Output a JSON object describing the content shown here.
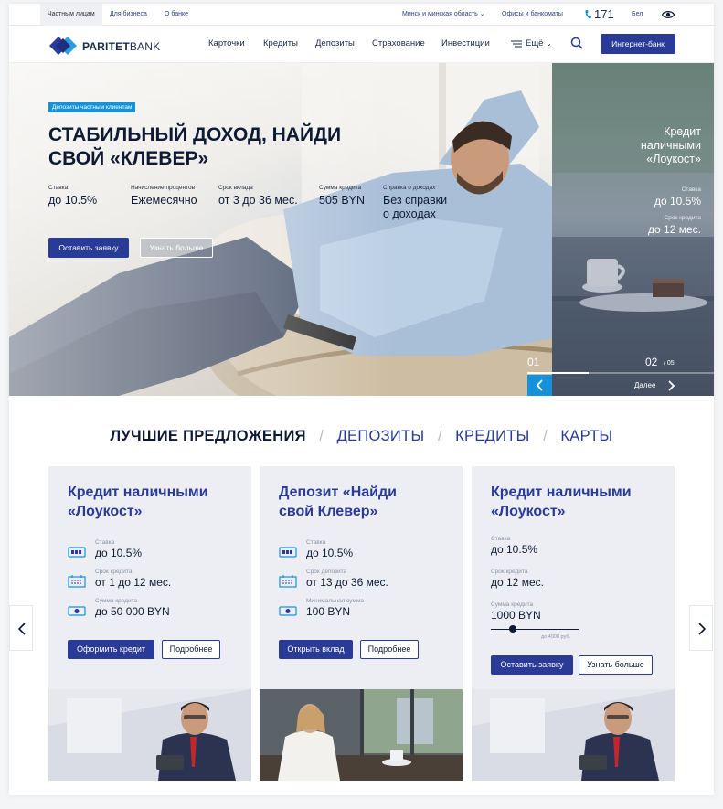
{
  "topbar": {
    "segments": [
      "Частным лицам",
      "Для бизнеса",
      "О банке"
    ],
    "region": "Минск и минская область",
    "offices": "Офисы и банкоматы",
    "phone": "171",
    "language": "Бел"
  },
  "header": {
    "brand_bold": "PARITET",
    "brand_rest": "BANK",
    "nav": [
      "Карточки",
      "Кредиты",
      "Депозиты",
      "Страхование",
      "Инвестиции",
      "Ещё"
    ],
    "internet_bank": "Интернет-банк"
  },
  "hero": {
    "tag": "Депозиты частным клиентам",
    "title_line1": "СТАБИЛЬНЫЙ ДОХОД, НАЙДИ",
    "title_line2": "СВОЙ «КЛЕВЕР»",
    "stats": [
      {
        "label": "Ставка",
        "value": "до 10.5%"
      },
      {
        "label": "Начисление процентов",
        "value": "Ежемесячно"
      },
      {
        "label": "Срок вклада",
        "value": "от 3 до 36 мес."
      },
      {
        "label": "Сумма кредита",
        "value": "505 BYN"
      },
      {
        "label": "Справка о доходах",
        "value_line1": "Без справки",
        "value_line2": "о доходах"
      }
    ],
    "primary_button": "Оставить заявку",
    "secondary_button": "Узнать больше"
  },
  "side_slide": {
    "title_line1": "Кредит",
    "title_line2": "наличными",
    "title_line3": "«Лоукост»",
    "rate_label": "Ставка",
    "rate_value": "до 10.5%",
    "term_label": "Срок кредита",
    "term_value": "до 12 мес."
  },
  "pager": {
    "current": "01",
    "next_index": "02",
    "total": "/ 05",
    "progress": 0.33,
    "next_label": "Далее"
  },
  "offers": {
    "active_tab": "ЛУЧШИЕ ПРЕДЛОЖЕНИЯ",
    "tabs": [
      "ДЕПОЗИТЫ",
      "КРЕДИТЫ",
      "КАРТЫ"
    ],
    "separator": "/"
  },
  "cards": [
    {
      "title_line1": "Кредит наличными",
      "title_line2": "«Лоукост»",
      "rows": [
        {
          "label": "Ставка",
          "value": "до 10.5%"
        },
        {
          "label": "Срок кредита",
          "value": "от 1 до 12 мес."
        },
        {
          "label": "Сумма кредита",
          "value": "до 50 000 BYN"
        }
      ],
      "primary_button": "Оформить кредит",
      "secondary_button": "Подробнее"
    },
    {
      "title_line1": "Депозит «Найди",
      "title_line2": "свой Клевер»",
      "rows": [
        {
          "label": "Ставка",
          "value": "до 10.5%"
        },
        {
          "label": "Срок депозита",
          "value": "от 13 до 36 мес."
        },
        {
          "label": "Минимальная сумма",
          "value": "100 BYN"
        }
      ],
      "primary_button": "Открыть вклад",
      "secondary_button": "Подробнее"
    },
    {
      "title_line1": "Кредит наличными",
      "title_line2": "«Лоукост»",
      "rows": [
        {
          "label": "Ставка",
          "value": "до 10.5%"
        },
        {
          "label": "Срок кредита",
          "value": "до 12 мес."
        },
        {
          "label": "Сумма кредита",
          "value": "1000 BYN"
        }
      ],
      "slider_position": 0.25,
      "slider_max_label": "до 4000 руб.",
      "primary_button": "Оставить заявку",
      "secondary_button": "Узнать больше"
    }
  ],
  "colors": {
    "brand_navy": "#2a3a97",
    "accent_blue": "#1592d9",
    "text_dark": "#0e1a33",
    "card_bg": "#eceef4"
  }
}
